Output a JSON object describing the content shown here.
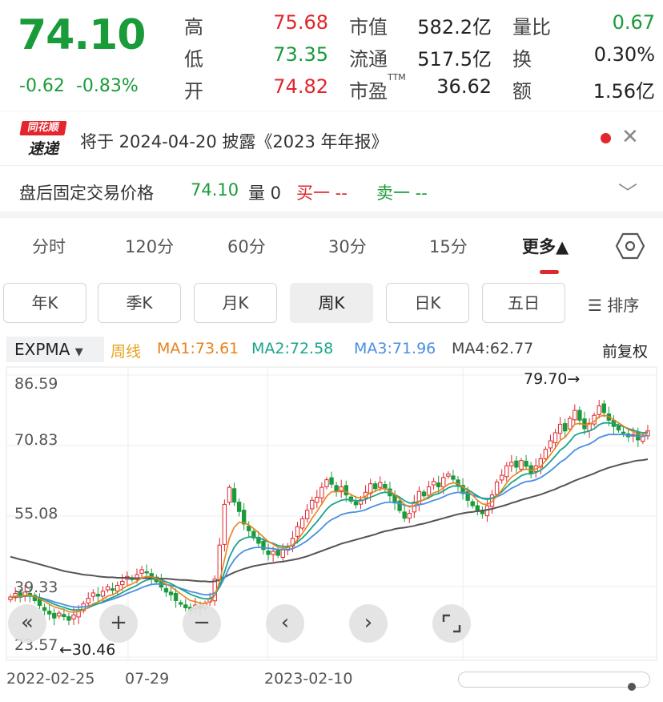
{
  "quote": {
    "price": "74.10",
    "change": "-0.62",
    "change_pct": "-0.83%",
    "high_label": "高",
    "high": "75.68",
    "low_label": "低",
    "low": "73.35",
    "open_label": "开",
    "open": "74.82",
    "mcap_label": "市值",
    "mcap": "582.2亿",
    "float_label": "流通",
    "float": "517.5亿",
    "pe_label": "市盈",
    "pe_sup": "TTM",
    "pe": "36.62",
    "vr_label": "量比",
    "vr": "0.67",
    "turn_label": "换",
    "turn": "0.30%",
    "amt_label": "额",
    "amt": "1.56亿"
  },
  "news": {
    "logo_top": "同花顺",
    "logo_bottom": "速递",
    "text": "将于 2024-04-20 披露《2023 年年报》"
  },
  "after_hours": {
    "label": "盘后固定交易价格",
    "price": "74.10",
    "volume": "量 0",
    "buy": "买一 --",
    "sell": "卖一 --"
  },
  "period_tabs": [
    "分时",
    "120分",
    "60分",
    "30分",
    "15分",
    "更多▲"
  ],
  "k_buttons": [
    "年K",
    "季K",
    "月K",
    "周K",
    "日K",
    "五日"
  ],
  "sort_label": "排序",
  "indicator": {
    "name": "EXPMA",
    "period": "周线",
    "ma1": "MA1:73.61",
    "ma2": "MA2:72.58",
    "ma3": "MA3:71.96",
    "ma4": "MA4:62.77",
    "adjust": "前复权"
  },
  "colors": {
    "up": "#e0262d",
    "down": "#1a9b3a",
    "ma1": "#e8821e",
    "ma2": "#1ba48a",
    "ma3": "#4b8fe0",
    "ma4": "#555555"
  },
  "chart_data": {
    "type": "candlestick",
    "y_ticks": [
      "86.59",
      "70.83",
      "55.08",
      "39.33",
      "23.57"
    ],
    "ylim": [
      23.57,
      86.59
    ],
    "max_label": "79.70→",
    "min_label": "←30.46",
    "x_labels": [
      "2022-02-25",
      "07-29",
      "2023-02-10"
    ],
    "close": [
      37.0,
      37.8,
      36.9,
      38.1,
      37.4,
      36.2,
      35.1,
      34.0,
      33.2,
      32.3,
      33.4,
      32.6,
      31.8,
      33.0,
      34.1,
      35.5,
      36.7,
      37.9,
      37.2,
      38.3,
      39.3,
      38.5,
      39.6,
      40.5,
      41.6,
      40.9,
      42.0,
      43.1,
      42.4,
      41.3,
      40.4,
      39.2,
      38.1,
      37.5,
      36.2,
      35.4,
      34.6,
      34.0,
      35.2,
      34.5,
      35.6,
      36.6,
      41.0,
      48.6,
      57.7,
      61.5,
      58.2,
      56.1,
      53.3,
      51.8,
      50.2,
      49.0,
      47.6,
      46.5,
      47.2,
      46.3,
      47.6,
      48.2,
      50.1,
      52.7,
      54.5,
      56.4,
      58.6,
      59.3,
      61.5,
      63.2,
      62.2,
      60.5,
      61.6,
      59.8,
      58.4,
      57.6,
      58.7,
      60.4,
      62.3,
      61.2,
      62.6,
      61.3,
      59.6,
      58.0,
      56.3,
      54.6,
      55.7,
      58.2,
      60.6,
      59.6,
      61.6,
      62.8,
      61.6,
      63.7,
      64.5,
      63.3,
      61.8,
      60.1,
      58.6,
      57.4,
      56.1,
      55.6,
      57.4,
      59.8,
      62.7,
      64.2,
      66.3,
      67.1,
      66.0,
      67.5,
      66.2,
      64.6,
      66.3,
      67.9,
      70.0,
      71.9,
      73.7,
      75.6,
      74.1,
      76.9,
      78.7,
      76.5,
      74.6,
      75.8,
      77.6,
      79.7,
      78.2,
      76.5,
      75.1,
      74.3,
      73.6,
      72.8,
      73.3,
      72.1,
      73.0,
      74.1
    ],
    "ma1": [
      37.0,
      37.2,
      37.1,
      37.4,
      37.4,
      37.1,
      36.6,
      36.0,
      35.4,
      34.8,
      34.5,
      34.2,
      33.7,
      33.6,
      33.7,
      34.1,
      34.7,
      35.5,
      35.9,
      36.5,
      37.2,
      37.5,
      38.1,
      38.8,
      39.5,
      39.9,
      40.5,
      41.3,
      41.6,
      41.5,
      41.2,
      40.6,
      39.9,
      39.3,
      38.5,
      37.7,
      36.9,
      36.2,
      36.0,
      35.6,
      35.6,
      35.9,
      37.3,
      40.5,
      45.4,
      50.1,
      52.6,
      53.7,
      53.6,
      53.1,
      52.3,
      51.4,
      50.4,
      49.4,
      48.8,
      48.1,
      47.9,
      48.0,
      48.6,
      49.8,
      51.2,
      52.8,
      54.6,
      56.1,
      57.8,
      59.5,
      60.5,
      60.5,
      60.8,
      60.5,
      59.9,
      59.3,
      59.1,
      59.5,
      60.3,
      60.6,
      61.2,
      61.2,
      60.7,
      59.9,
      58.9,
      57.7,
      57.1,
      57.4,
      58.3,
      58.7,
      59.5,
      60.3,
      60.6,
      61.4,
      62.2,
      62.5,
      62.3,
      61.6,
      60.7,
      59.7,
      58.6,
      57.8,
      57.7,
      58.3,
      59.6,
      60.9,
      62.5,
      63.8,
      64.5,
      65.3,
      65.6,
      65.3,
      65.6,
      66.2,
      67.4,
      68.8,
      70.3,
      72.0,
      72.7,
      74.1,
      75.6,
      75.8,
      75.5,
      75.6,
      76.2,
      77.3,
      77.6,
      77.3,
      76.6,
      75.9,
      75.2,
      74.4,
      74.0,
      73.4,
      73.3,
      73.6
    ],
    "ma2": [
      37.0,
      37.1,
      37.1,
      37.2,
      37.3,
      37.1,
      36.8,
      36.4,
      35.9,
      35.4,
      35.0,
      34.7,
      34.3,
      34.1,
      34.1,
      34.2,
      34.6,
      35.1,
      35.5,
      35.9,
      36.5,
      36.9,
      37.4,
      38.0,
      38.6,
      39.1,
      39.6,
      40.3,
      40.8,
      41.0,
      41.0,
      40.8,
      40.4,
      40.0,
      39.4,
      38.8,
      38.2,
      37.6,
      37.2,
      36.8,
      36.6,
      36.6,
      37.4,
      39.4,
      42.6,
      45.9,
      48.1,
      49.5,
      50.1,
      50.4,
      50.4,
      50.2,
      49.8,
      49.3,
      49.0,
      48.5,
      48.3,
      48.3,
      48.5,
      49.3,
      50.2,
      51.3,
      52.6,
      53.8,
      55.2,
      56.6,
      57.6,
      58.1,
      58.6,
      58.8,
      58.7,
      58.5,
      58.5,
      58.8,
      59.3,
      59.7,
      60.2,
      60.4,
      60.3,
      59.9,
      59.3,
      58.5,
      58.0,
      58.0,
      58.4,
      58.7,
      59.2,
      59.8,
      60.1,
      60.7,
      61.4,
      61.8,
      61.8,
      61.5,
      61.0,
      60.3,
      59.6,
      59.0,
      58.8,
      59.0,
      59.7,
      60.5,
      61.6,
      62.6,
      63.3,
      64.1,
      64.5,
      64.5,
      64.8,
      65.3,
      66.2,
      67.3,
      68.5,
      69.8,
      70.6,
      71.8,
      73.1,
      73.6,
      73.8,
      74.1,
      74.6,
      75.5,
      75.9,
      75.9,
      75.7,
      75.4,
      75.1,
      74.6,
      74.3,
      73.9,
      73.7,
      73.8
    ],
    "ma3": [
      37.0,
      37.1,
      37.0,
      37.2,
      37.2,
      37.1,
      36.9,
      36.6,
      36.3,
      35.9,
      35.6,
      35.3,
      35.0,
      34.8,
      34.7,
      34.8,
      35.0,
      35.3,
      35.5,
      35.8,
      36.2,
      36.5,
      36.9,
      37.3,
      37.8,
      38.2,
      38.6,
      39.1,
      39.5,
      39.8,
      39.9,
      39.9,
      39.8,
      39.6,
      39.3,
      38.9,
      38.6,
      38.2,
      38.0,
      37.7,
      37.5,
      37.5,
      37.9,
      39.2,
      41.3,
      43.6,
      45.3,
      46.5,
      47.3,
      47.7,
      48.0,
      48.1,
      48.0,
      47.9,
      47.8,
      47.6,
      47.6,
      47.6,
      47.8,
      48.3,
      48.9,
      49.6,
      50.5,
      51.4,
      52.4,
      53.5,
      54.3,
      54.8,
      55.4,
      55.7,
      55.9,
      56.0,
      56.2,
      56.5,
      57.0,
      57.4,
      57.8,
      58.1,
      58.2,
      58.1,
      57.9,
      57.5,
      57.3,
      57.3,
      57.6,
      57.8,
      58.2,
      58.6,
      58.9,
      59.4,
      59.9,
      60.2,
      60.4,
      60.3,
      60.1,
      59.8,
      59.4,
      59.1,
      59.0,
      59.1,
      59.4,
      59.9,
      60.6,
      61.3,
      61.8,
      62.4,
      62.8,
      62.9,
      63.2,
      63.7,
      64.4,
      65.2,
      66.1,
      67.1,
      67.8,
      68.8,
      69.8,
      70.4,
      70.8,
      71.2,
      71.8,
      72.6,
      73.0,
      73.3,
      73.3,
      73.3,
      73.3,
      73.1,
      73.1,
      72.9,
      72.9,
      73.1
    ],
    "ma4": [
      46.0,
      45.7,
      45.4,
      45.2,
      44.9,
      44.6,
      44.3,
      44.0,
      43.7,
      43.4,
      43.1,
      42.8,
      42.6,
      42.4,
      42.2,
      42.0,
      41.9,
      41.8,
      41.6,
      41.5,
      41.4,
      41.4,
      41.3,
      41.3,
      41.3,
      41.2,
      41.2,
      41.2,
      41.2,
      41.2,
      41.2,
      41.1,
      41.1,
      41.0,
      40.9,
      40.8,
      40.8,
      40.7,
      40.6,
      40.5,
      40.5,
      40.4,
      40.5,
      40.8,
      41.4,
      42.0,
      42.5,
      42.9,
      43.3,
      43.6,
      43.9,
      44.1,
      44.3,
      44.5,
      44.6,
      44.8,
      44.9,
      45.1,
      45.3,
      45.5,
      45.8,
      46.1,
      46.5,
      46.9,
      47.3,
      47.7,
      48.1,
      48.5,
      48.9,
      49.2,
      49.5,
      49.8,
      50.1,
      50.4,
      50.7,
      51.0,
      51.4,
      51.7,
      51.9,
      52.2,
      52.4,
      52.5,
      52.7,
      52.9,
      53.2,
      53.4,
      53.7,
      54.0,
      54.3,
      54.6,
      54.9,
      55.2,
      55.5,
      55.7,
      55.9,
      56.0,
      56.2,
      56.3,
      56.5,
      56.7,
      57.0,
      57.3,
      57.6,
      58.0,
      58.3,
      58.7,
      59.0,
      59.3,
      59.6,
      59.9,
      60.3,
      60.7,
      61.1,
      61.6,
      62.0,
      62.5,
      63.0,
      63.4,
      63.8,
      64.2,
      64.6,
      65.1,
      65.5,
      65.9,
      66.2,
      66.5,
      66.8,
      67.0,
      67.3,
      67.5,
      67.6,
      67.8
    ]
  }
}
